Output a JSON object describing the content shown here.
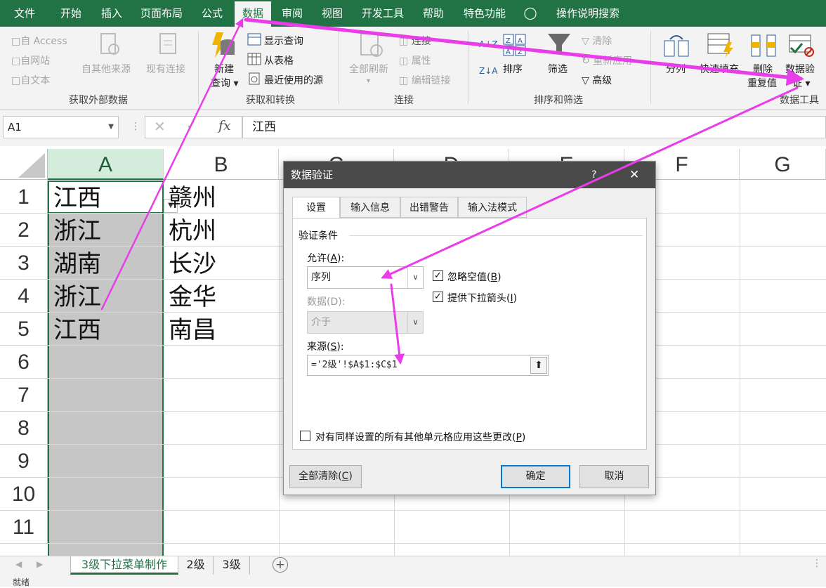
{
  "ribbon_tabs": [
    "文件",
    "开始",
    "插入",
    "页面布局",
    "公式",
    "数据",
    "审阅",
    "视图",
    "开发工具",
    "帮助",
    "特色功能"
  ],
  "tell_me": "操作说明搜索",
  "groups": {
    "get_external": {
      "title": "获取外部数据",
      "access": "自 Access",
      "web": "自网站",
      "text": "自文本",
      "other": "自其他来源",
      "existing": "现有连接"
    },
    "get_transform": {
      "title": "获取和转换",
      "new_query_line1": "新建",
      "new_query_line2": "查询",
      "show_queries": "显示查询",
      "from_table": "从表格",
      "recent_sources": "最近使用的源"
    },
    "connections": {
      "title": "连接",
      "refresh_all": "全部刷新",
      "connections": "连接",
      "properties": "属性",
      "edit_links": "编辑链接"
    },
    "sort_filter": {
      "title": "排序和筛选",
      "sort": "排序",
      "filter": "筛选",
      "clear": "清除",
      "reapply": "重新应用",
      "advanced": "高级"
    },
    "data_tools": {
      "title": "数据工具",
      "text_to_columns": "分列",
      "flash_fill": "快速填充",
      "remove_dup_line1": "删除",
      "remove_dup_line2": "重复值",
      "validation_line1": "数据验",
      "validation_line2": "证"
    }
  },
  "formula_bar": {
    "name_box": "A1",
    "formula": "江西"
  },
  "columns": [
    "A",
    "B",
    "C",
    "D",
    "E",
    "F",
    "G"
  ],
  "rows": [
    {
      "num": "1",
      "a": "江西",
      "b": "赣州"
    },
    {
      "num": "2",
      "a": "浙江",
      "b": "杭州"
    },
    {
      "num": "3",
      "a": "湖南",
      "b": "长沙"
    },
    {
      "num": "4",
      "a": "浙江",
      "b": "金华"
    },
    {
      "num": "5",
      "a": "江西",
      "b": "南昌"
    },
    {
      "num": "6",
      "a": "",
      "b": ""
    },
    {
      "num": "7",
      "a": "",
      "b": ""
    },
    {
      "num": "8",
      "a": "",
      "b": ""
    },
    {
      "num": "9",
      "a": "",
      "b": ""
    },
    {
      "num": "10",
      "a": "",
      "b": ""
    },
    {
      "num": "11",
      "a": "",
      "b": ""
    }
  ],
  "sheet_tabs": [
    "3级下拉菜单制作",
    "2级",
    "3级"
  ],
  "status": "就绪",
  "dialog": {
    "title": "数据验证",
    "help": "?",
    "tabs": [
      "设置",
      "输入信息",
      "出错警告",
      "输入法模式"
    ],
    "section": "验证条件",
    "allow_label": "允许(",
    "allow_key": "A",
    "allow_value": "序列",
    "data_label": "数据(D):",
    "data_value": "介于",
    "ignore_blank": "忽略空值(",
    "ignore_blank_key": "B",
    "dropdown": "提供下拉箭头(",
    "dropdown_key": "I",
    "source_label": "来源(",
    "source_key": "S",
    "source_value": "='2级'!$A$1:$C$1",
    "apply_all": "对有同样设置的所有其他单元格应用这些更改(",
    "apply_all_key": "P",
    "clear_all": "全部清除(",
    "clear_all_key": "C",
    "ok": "确定",
    "cancel": "取消"
  },
  "colors": {
    "excel_green": "#217346",
    "annotation": "#e83de8"
  }
}
